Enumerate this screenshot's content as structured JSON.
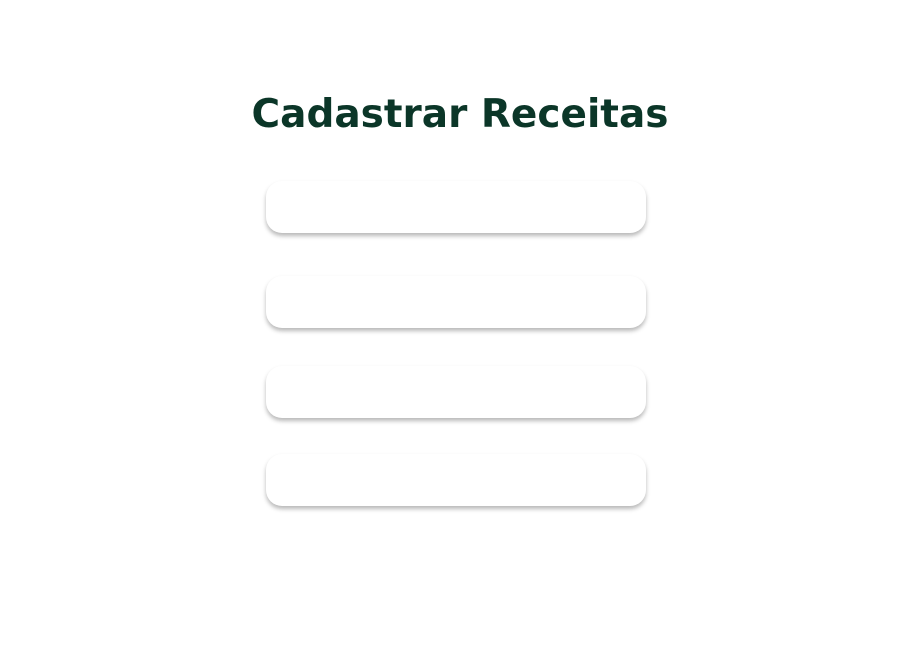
{
  "page": {
    "title": "Cadastrar Receitas",
    "title_color": "#0b3628"
  },
  "form": {
    "fields": [
      {
        "value": "",
        "placeholder": ""
      },
      {
        "value": "",
        "placeholder": ""
      },
      {
        "value": "",
        "placeholder": ""
      },
      {
        "value": "",
        "placeholder": ""
      }
    ]
  }
}
